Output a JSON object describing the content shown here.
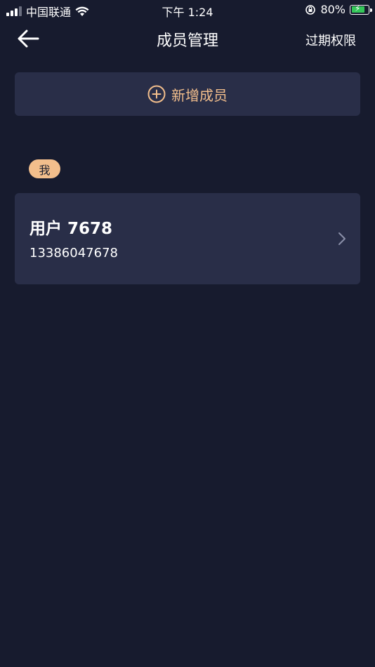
{
  "status_bar": {
    "carrier": "中国联通",
    "time": "下午 1:24",
    "battery_text": "80%",
    "battery_level": 0.8
  },
  "nav": {
    "title": "成员管理",
    "right_action": "过期权限"
  },
  "add_member": {
    "label": "新增成员"
  },
  "badge": {
    "label": "我"
  },
  "member": {
    "name": "用户 7678",
    "phone": "13386047678"
  },
  "colors": {
    "background": "#171b2e",
    "card": "#292e48",
    "accent": "#f2be8c",
    "battery_green": "#34c759"
  }
}
